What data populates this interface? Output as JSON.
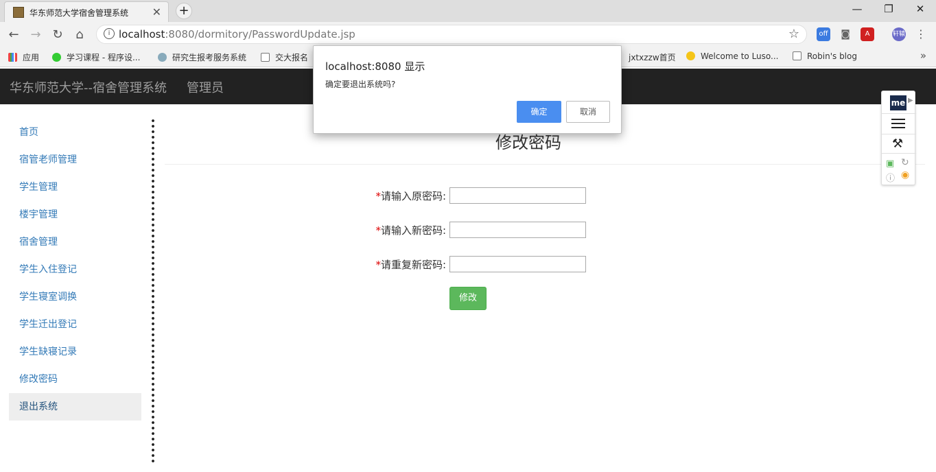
{
  "browser": {
    "tab_title": "华东师范大学宿舍管理系统",
    "url_host": "localhost",
    "url_path": ":8080/dormitory/PasswordUpdate.jsp"
  },
  "bookmarks": [
    {
      "label": "应用",
      "icon": "apps-grid-icon"
    },
    {
      "label": "学习课程 - 程序设...",
      "icon": "course-icon"
    },
    {
      "label": "研究生报考服务系统",
      "icon": "university-icon"
    },
    {
      "label": "交大报名",
      "icon": "page-icon"
    },
    {
      "label": "jxtxzzw首页",
      "icon": "site-icon"
    },
    {
      "label": "Welcome to Luso...",
      "icon": "star-badge-icon"
    },
    {
      "label": "Robin's blog",
      "icon": "page-icon"
    }
  ],
  "navbar": {
    "brand": "华东师范大学--宿舍管理系统",
    "role": "管理员"
  },
  "sidebar": {
    "items": [
      {
        "label": "首页"
      },
      {
        "label": "宿管老师管理"
      },
      {
        "label": "学生管理"
      },
      {
        "label": "楼宇管理"
      },
      {
        "label": "宿舍管理"
      },
      {
        "label": "学生入住登记"
      },
      {
        "label": "学生寝室调换"
      },
      {
        "label": "学生迁出登记"
      },
      {
        "label": "学生缺寝记录"
      },
      {
        "label": "修改密码"
      },
      {
        "label": "退出系统"
      }
    ]
  },
  "main": {
    "title": "修改密码",
    "required_mark": "*",
    "fields": [
      {
        "label": "请输入原密码:",
        "value": ""
      },
      {
        "label": "请输入新密码:",
        "value": ""
      },
      {
        "label": "请重复新密码:",
        "value": ""
      }
    ],
    "submit_label": "修改"
  },
  "dialog": {
    "title": "localhost:8080 显示",
    "message": "确定要退出系统吗?",
    "ok_label": "确定",
    "cancel_label": "取消"
  },
  "extensions": {
    "off_badge": "off",
    "profile_badge": "轩辕",
    "me_logo": "me"
  },
  "colors": {
    "navbar_bg": "#222222",
    "link": "#337ab7",
    "submit_green": "#5cb85c",
    "dialog_ok": "#4a8ef0"
  }
}
